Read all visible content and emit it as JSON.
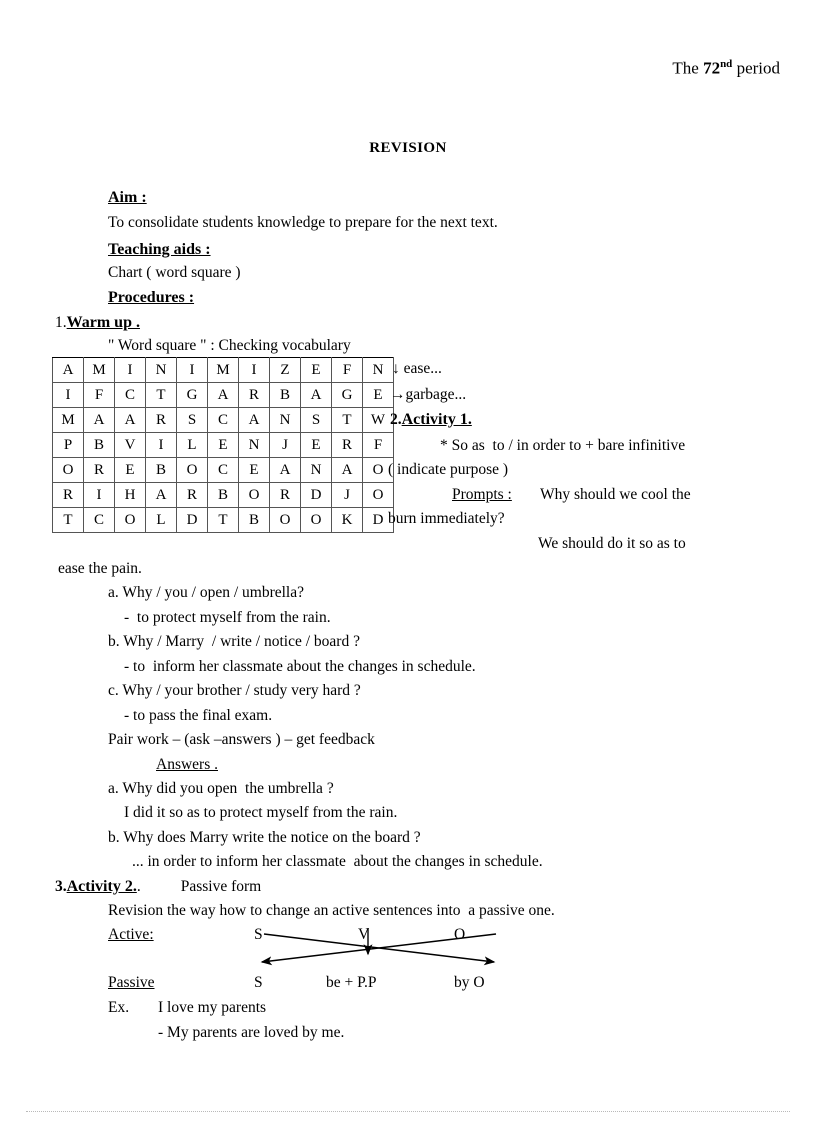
{
  "document": {
    "header_period_prefix": "The ",
    "header_period_number": "72",
    "header_period_sup": "nd",
    "header_period_suffix": " period",
    "title": "REVISION",
    "labels": {
      "aim": "Aim :",
      "aim_text": "To consolidate students knowledge to prepare for the next text.",
      "teaching_aids": "Teaching aids :",
      "teaching_aids_text": "Chart ( word square )",
      "procedures": "Procedures :",
      "warm_up_number": "1.",
      "warm_up": "Warm up .",
      "word_square_caption": "\" Word square \" : Checking vocabulary"
    },
    "grid_annotations": {
      "ease": "↓ ease...",
      "garbage": "→garbage..."
    },
    "activity1": {
      "number": "2.",
      "heading": "Activity 1.",
      "rule": "* So as  to / in order to + bare infinitive",
      "purpose": "( indicate purpose )",
      "prompts_label": "Prompts :",
      "prompt_question_line1": "Why should we cool the",
      "prompt_question_line2": "burn immediately?",
      "prompt_answer_line1": "We should do it so as to",
      "prompt_answer_line2": "ease the pain.",
      "items": [
        "a. Why / you / open / umbrella?",
        "-  to protect myself from the rain.",
        "b. Why / Marry  / write / notice / board ?",
        "- to  inform her classmate about the changes in schedule.",
        "c. Why / your brother / study very hard ?",
        "- to pass the final exam."
      ],
      "pair_work": "Pair work – (ask –answers ) – get feedback",
      "answers_label": "Answers .",
      "answers": [
        "a. Why did you open  the umbrella ?",
        "I did it so as to protect myself from the rain.",
        "b. Why does Marry write the notice on the board ?",
        "... in order to inform her classmate  about the changes in schedule."
      ]
    },
    "activity2": {
      "number": "3.",
      "heading": "Activity 2.",
      "subtitle": "Passive form",
      "revision_line": "Revision the way how to change an active sentences into  a passive one.",
      "active_label": "Active:",
      "passive_label": "Passive",
      "active_terms": [
        "S",
        "V",
        "O"
      ],
      "passive_terms": [
        "S",
        "be + P.P",
        "by O"
      ],
      "example_label": "Ex.",
      "example_active": "I love my parents",
      "example_passive": "- My parents are loved by me."
    },
    "word_square": {
      "rows": 7,
      "cols": 11,
      "letters": [
        [
          "A",
          "M",
          "I",
          "N",
          "I",
          "M",
          "I",
          "Z",
          "E",
          "F",
          "N"
        ],
        [
          "I",
          "F",
          "C",
          "T",
          "G",
          "A",
          "R",
          "B",
          "A",
          "G",
          "E"
        ],
        [
          "M",
          "A",
          "A",
          "R",
          "S",
          "C",
          "A",
          "N",
          "S",
          "T",
          "W"
        ],
        [
          "P",
          "B",
          "V",
          "I",
          "L",
          "E",
          "N",
          "J",
          "E",
          "R",
          "F"
        ],
        [
          "O",
          "R",
          "E",
          "B",
          "O",
          "C",
          "E",
          "A",
          "N",
          "A",
          "O"
        ],
        [
          "R",
          "I",
          "H",
          "A",
          "R",
          "B",
          "O",
          "R",
          "D",
          "J",
          "O"
        ],
        [
          "T",
          "C",
          "O",
          "L",
          "D",
          "T",
          "B",
          "O",
          "O",
          "K",
          "D"
        ]
      ]
    }
  }
}
